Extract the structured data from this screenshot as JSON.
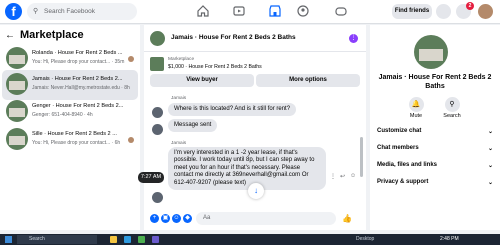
{
  "topbar": {
    "search_placeholder": "Search Facebook",
    "find_friends": "Find friends",
    "notif_count": "2"
  },
  "sidebar": {
    "title": "Marketplace",
    "conversations": [
      {
        "title": "Rolanda · House For Rent 2 Beds ...",
        "preview": "You: Hi, Please drop your contact... · 35m",
        "active": false
      },
      {
        "title": "Jamais · House For Rent 2 Beds 2...",
        "preview": "Jamais: Never.Hall@my.metrostate.edu · 8h",
        "active": true
      },
      {
        "title": "Genger · House For Rent 2 Beds 2...",
        "preview": "Genger: 651-404-8940 · 4h",
        "active": false
      },
      {
        "title": "Sille · House For Rent 2 Beds 2 ...",
        "preview": "You: Hi, Please drop your contact... · 6h",
        "active": false
      }
    ]
  },
  "chat": {
    "title": "Jamais · House For Rent 2 Beds 2 Baths",
    "listing_label": "Marketplace",
    "listing_text": "$1,000 · House For Rent 2 Beds 2 Baths",
    "view_buyer": "View buyer",
    "more_options": "More options",
    "messages": [
      {
        "sender": "Jamais",
        "text": "Where is this located? And is it still for rent?"
      },
      {
        "sender": "",
        "text": "Message sent"
      },
      {
        "sender": "Jamais",
        "text": "I'm very interested in a 1 -2 year lease, if that's possible. I work today until 8p, but I can step away to meet you for an hour if that's necessary. Please contact me directly at 369neverhall@gmail.com Or 612-407-9207 (please text)"
      }
    ],
    "time_tip": "7:27 AM",
    "composer_placeholder": "Aa"
  },
  "right_panel": {
    "title": "Jamais · House For Rent 2 Beds 2 Baths",
    "actions": [
      "Mute",
      "Search"
    ],
    "rows": [
      "Customize chat",
      "Chat members",
      "Media, files and links",
      "Privacy & support"
    ]
  },
  "taskbar": {
    "search": "Search",
    "desktop": "Desktop",
    "time": "2:48 PM"
  }
}
